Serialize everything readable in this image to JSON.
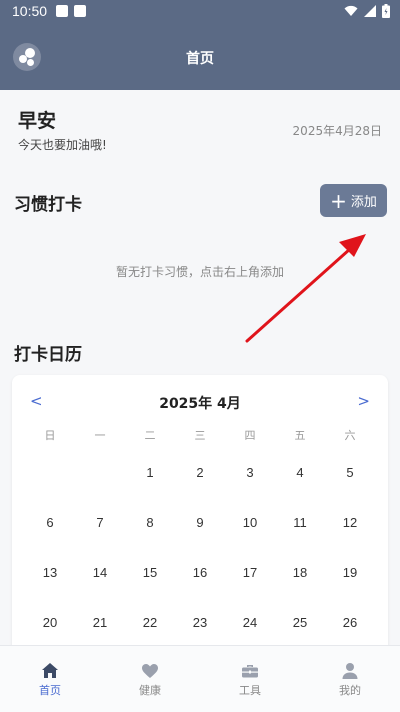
{
  "status_bar": {
    "time": "10:50"
  },
  "app_bar": {
    "title": "首页"
  },
  "greeting": {
    "title": "早安",
    "subtitle": "今天也要加油哦!",
    "date": "2025年4月28日"
  },
  "habits": {
    "title": "习惯打卡",
    "add_button": {
      "icon": "plus-icon",
      "label": "添加"
    },
    "empty_text": "暂无打卡习惯，点击右上角添加"
  },
  "calendar": {
    "title": "打卡日历",
    "prev": "<",
    "next": ">",
    "month_label": "2025年 4月",
    "weekdays": [
      "日",
      "一",
      "二",
      "三",
      "四",
      "五",
      "六"
    ],
    "weeks": [
      [
        "",
        "",
        "1",
        "2",
        "3",
        "4",
        "5"
      ],
      [
        "6",
        "7",
        "8",
        "9",
        "10",
        "11",
        "12"
      ],
      [
        "13",
        "14",
        "15",
        "16",
        "17",
        "18",
        "19"
      ],
      [
        "20",
        "21",
        "22",
        "23",
        "24",
        "25",
        "26"
      ]
    ]
  },
  "nav": [
    {
      "label": "首页",
      "icon": "home-icon",
      "active": true
    },
    {
      "label": "健康",
      "icon": "heart-icon",
      "active": false
    },
    {
      "label": "工具",
      "icon": "toolbox-icon",
      "active": false
    },
    {
      "label": "我的",
      "icon": "user-icon",
      "active": false
    }
  ],
  "colors": {
    "primary": "#5b6a85",
    "accent": "#4a6bd0",
    "arrow": "#e0141b"
  }
}
